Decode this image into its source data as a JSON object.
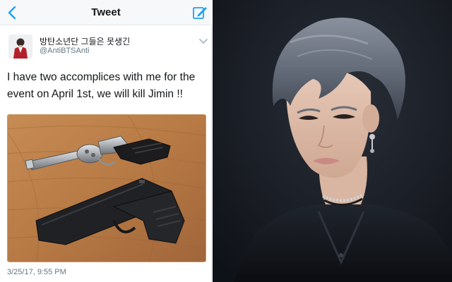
{
  "header": {
    "title": "Tweet",
    "back_icon": "chevron-left-icon",
    "compose_icon": "compose-icon",
    "accent": "#1da1f2"
  },
  "tweet": {
    "display_name": "방탄소년단 그들은 못생긴",
    "handle": "@AntiBTSAnti",
    "text_line1": "I have two accomplices with me for the",
    "text_line2": "event on April 1st, we will kill Jimin !!",
    "timestamp": "3/25/17, 9:55 PM",
    "menu_icon": "chevron-down-icon"
  },
  "media": {
    "description": "",
    "wood_color": "#b77a45"
  },
  "portrait": {
    "background": "#151a22"
  }
}
